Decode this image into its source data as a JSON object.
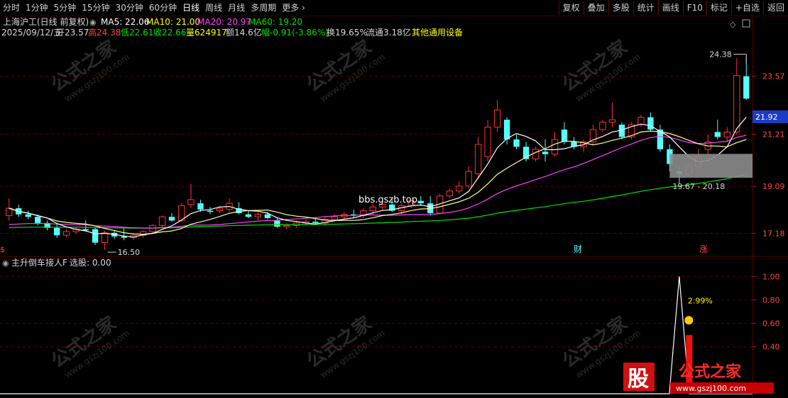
{
  "toolbar": {
    "period_tabs": [
      "分时",
      "1分钟",
      "5分钟",
      "15分钟",
      "30分钟",
      "60分钟",
      "日线",
      "周线",
      "月线",
      "多周期",
      "更多"
    ],
    "active_tab": "日线",
    "right_buttons": [
      "复权",
      "叠加",
      "多股",
      "统计",
      "画线",
      "F10",
      "标记",
      "+自选",
      "返回"
    ]
  },
  "header": {
    "title": "上海沪工(日线 前复权)",
    "ma5": "MA5: 22.06",
    "ma10": "MA10: 21.00",
    "ma20": "MA20: 20.97",
    "ma60": "MA60: 19.20",
    "date": "2025/09/12/五",
    "open": "开23.57",
    "high": "高24.38",
    "low": "低22.61",
    "close": "收22.66",
    "volume": "量624917",
    "amount": "额14.6亿",
    "change": "幅-0.91(-3.86%)",
    "turnover": "换19.65%",
    "float_cap": "流通3.18亿",
    "sector": "其他通用设备"
  },
  "colors": {
    "up": "#ff3232",
    "down": "#54ffff",
    "ma5": "#ffffff",
    "ma10": "#ffff00",
    "ma20": "#ff40ff",
    "ma60": "#00e000",
    "grid": "#5a0000",
    "axis_text": "#ff4444",
    "current_price_box": "#1c3cc8"
  },
  "chart_data": [
    {
      "type": "candlestick",
      "title": "上海沪工(日线 前复权)",
      "y_ticks": [
        17.18,
        19.09,
        21.21,
        23.57
      ],
      "ylim": [
        16.3,
        25.0
      ],
      "current_price": "21.92",
      "candles": [
        {
          "o": 17.9,
          "h": 18.6,
          "l": 17.7,
          "c": 18.2
        },
        {
          "o": 18.2,
          "h": 18.35,
          "l": 17.85,
          "c": 17.95
        },
        {
          "o": 17.95,
          "h": 18.1,
          "l": 17.75,
          "c": 17.85
        },
        {
          "o": 17.85,
          "h": 17.95,
          "l": 17.5,
          "c": 17.6
        },
        {
          "o": 17.6,
          "h": 17.7,
          "l": 17.3,
          "c": 17.4
        },
        {
          "o": 17.4,
          "h": 17.55,
          "l": 17.0,
          "c": 17.1
        },
        {
          "o": 17.1,
          "h": 17.35,
          "l": 17.0,
          "c": 17.25
        },
        {
          "o": 17.25,
          "h": 17.45,
          "l": 17.15,
          "c": 17.35
        },
        {
          "o": 17.35,
          "h": 17.7,
          "l": 17.25,
          "c": 17.3
        },
        {
          "o": 17.35,
          "h": 17.4,
          "l": 16.7,
          "c": 16.8
        },
        {
          "o": 16.8,
          "h": 17.3,
          "l": 16.5,
          "c": 17.2
        },
        {
          "o": 17.2,
          "h": 17.3,
          "l": 16.95,
          "c": 17.05
        },
        {
          "o": 17.05,
          "h": 17.4,
          "l": 16.9,
          "c": 17.0
        },
        {
          "o": 17.0,
          "h": 17.2,
          "l": 16.9,
          "c": 17.1
        },
        {
          "o": 17.1,
          "h": 17.3,
          "l": 17.0,
          "c": 17.25
        },
        {
          "o": 17.25,
          "h": 17.55,
          "l": 17.15,
          "c": 17.5
        },
        {
          "o": 17.5,
          "h": 17.9,
          "l": 17.4,
          "c": 17.85
        },
        {
          "o": 17.85,
          "h": 18.0,
          "l": 17.65,
          "c": 17.7
        },
        {
          "o": 17.7,
          "h": 18.4,
          "l": 17.65,
          "c": 18.3
        },
        {
          "o": 18.35,
          "h": 19.2,
          "l": 18.2,
          "c": 18.55
        },
        {
          "o": 18.4,
          "h": 18.55,
          "l": 18.05,
          "c": 18.15
        },
        {
          "o": 18.1,
          "h": 18.25,
          "l": 17.95,
          "c": 18.05
        },
        {
          "o": 18.1,
          "h": 18.3,
          "l": 18.0,
          "c": 18.2
        },
        {
          "o": 18.15,
          "h": 18.6,
          "l": 18.05,
          "c": 18.4
        },
        {
          "o": 18.2,
          "h": 18.45,
          "l": 17.95,
          "c": 18.0
        },
        {
          "o": 17.95,
          "h": 18.1,
          "l": 17.8,
          "c": 17.85
        },
        {
          "o": 17.85,
          "h": 18.05,
          "l": 17.7,
          "c": 17.95
        },
        {
          "o": 17.95,
          "h": 18.05,
          "l": 17.75,
          "c": 17.8
        },
        {
          "o": 17.7,
          "h": 17.8,
          "l": 17.4,
          "c": 17.45
        },
        {
          "o": 17.45,
          "h": 17.6,
          "l": 17.35,
          "c": 17.5
        },
        {
          "o": 17.5,
          "h": 17.7,
          "l": 17.4,
          "c": 17.6
        },
        {
          "o": 17.6,
          "h": 17.75,
          "l": 17.5,
          "c": 17.65
        },
        {
          "o": 17.65,
          "h": 17.8,
          "l": 17.55,
          "c": 17.6
        },
        {
          "o": 17.6,
          "h": 17.85,
          "l": 17.5,
          "c": 17.75
        },
        {
          "o": 17.75,
          "h": 17.95,
          "l": 17.65,
          "c": 17.85
        },
        {
          "o": 17.85,
          "h": 18.05,
          "l": 17.75,
          "c": 17.95
        },
        {
          "o": 17.95,
          "h": 18.15,
          "l": 17.8,
          "c": 17.9
        },
        {
          "o": 17.9,
          "h": 18.2,
          "l": 17.8,
          "c": 18.1
        },
        {
          "o": 18.1,
          "h": 18.4,
          "l": 17.95,
          "c": 18.25
        },
        {
          "o": 18.25,
          "h": 18.55,
          "l": 18.1,
          "c": 18.35
        },
        {
          "o": 18.35,
          "h": 18.6,
          "l": 18.05,
          "c": 18.1
        },
        {
          "o": 18.1,
          "h": 18.4,
          "l": 17.95,
          "c": 18.3
        },
        {
          "o": 18.3,
          "h": 18.55,
          "l": 18.2,
          "c": 18.5
        },
        {
          "o": 18.5,
          "h": 18.7,
          "l": 18.3,
          "c": 18.4
        },
        {
          "o": 18.4,
          "h": 18.7,
          "l": 17.9,
          "c": 18.0
        },
        {
          "o": 18.0,
          "h": 18.8,
          "l": 17.95,
          "c": 18.7
        },
        {
          "o": 18.7,
          "h": 19.0,
          "l": 18.6,
          "c": 18.9
        },
        {
          "o": 18.9,
          "h": 19.3,
          "l": 18.8,
          "c": 19.1
        },
        {
          "o": 19.1,
          "h": 19.9,
          "l": 19.0,
          "c": 19.7
        },
        {
          "o": 19.6,
          "h": 21.1,
          "l": 19.4,
          "c": 20.8
        },
        {
          "o": 20.3,
          "h": 21.8,
          "l": 20.1,
          "c": 21.5
        },
        {
          "o": 21.5,
          "h": 22.6,
          "l": 21.3,
          "c": 22.2
        },
        {
          "o": 21.8,
          "h": 21.9,
          "l": 20.8,
          "c": 21.0
        },
        {
          "o": 21.0,
          "h": 21.2,
          "l": 20.6,
          "c": 20.7
        },
        {
          "o": 20.7,
          "h": 20.9,
          "l": 20.1,
          "c": 20.2
        },
        {
          "o": 20.2,
          "h": 20.7,
          "l": 20.1,
          "c": 20.6
        },
        {
          "o": 20.5,
          "h": 21.0,
          "l": 20.1,
          "c": 20.4
        },
        {
          "o": 20.4,
          "h": 21.3,
          "l": 20.3,
          "c": 21.0
        },
        {
          "o": 21.4,
          "h": 21.7,
          "l": 20.8,
          "c": 20.9
        },
        {
          "o": 20.9,
          "h": 21.1,
          "l": 20.6,
          "c": 20.7
        },
        {
          "o": 20.7,
          "h": 21.0,
          "l": 20.5,
          "c": 20.9
        },
        {
          "o": 20.9,
          "h": 21.6,
          "l": 20.8,
          "c": 21.4
        },
        {
          "o": 21.4,
          "h": 21.8,
          "l": 21.3,
          "c": 21.7
        },
        {
          "o": 21.7,
          "h": 22.5,
          "l": 21.5,
          "c": 21.8
        },
        {
          "o": 21.6,
          "h": 21.7,
          "l": 21.0,
          "c": 21.1
        },
        {
          "o": 21.1,
          "h": 21.7,
          "l": 21.0,
          "c": 21.6
        },
        {
          "o": 21.6,
          "h": 22.0,
          "l": 21.5,
          "c": 21.9
        },
        {
          "o": 21.9,
          "h": 22.1,
          "l": 21.3,
          "c": 21.4
        },
        {
          "o": 21.4,
          "h": 21.6,
          "l": 20.5,
          "c": 20.6
        },
        {
          "o": 20.6,
          "h": 20.8,
          "l": 19.7,
          "c": 20.0
        },
        {
          "o": 19.7,
          "h": 19.9,
          "l": 19.2,
          "c": 19.6
        },
        {
          "o": 19.6,
          "h": 20.1,
          "l": 19.5,
          "c": 19.9
        },
        {
          "o": 19.9,
          "h": 20.6,
          "l": 19.8,
          "c": 20.3
        },
        {
          "o": 20.6,
          "h": 21.2,
          "l": 20.4,
          "c": 20.9
        },
        {
          "o": 21.3,
          "h": 21.8,
          "l": 21.0,
          "c": 21.1
        },
        {
          "o": 21.1,
          "h": 21.5,
          "l": 20.9,
          "c": 21.3
        },
        {
          "o": 21.3,
          "h": 24.3,
          "l": 21.2,
          "c": 23.6
        },
        {
          "o": 23.57,
          "h": 24.38,
          "l": 22.61,
          "c": 22.66
        }
      ],
      "annotations": {
        "low_marker": "16.50",
        "high_marker": "24.38",
        "range_label": "19.67 - 20.18",
        "range_low": 19.67,
        "range_high": 20.18,
        "watermark_text": "bbs.gszb.top",
        "event_cai": "财",
        "event_zhang": "涨",
        "corner_mark": "$"
      }
    },
    {
      "type": "line",
      "title": "主升倒车接人F",
      "value_label": "选股: 0.00",
      "y_ticks": [
        0.4,
        0.6,
        0.8,
        1.0
      ],
      "ylim": [
        0,
        1.05
      ],
      "signal_index": 70,
      "signal_value": 1.0,
      "signal_text": "2.99%",
      "bar_value": 0.5,
      "bar_index": 71
    }
  ],
  "watermark": {
    "brand_left": "股",
    "brand_right": "公式之家",
    "url": "www.gszj100.com",
    "tile_text": "公式之家",
    "tile_url": "www.gszj100.com"
  }
}
